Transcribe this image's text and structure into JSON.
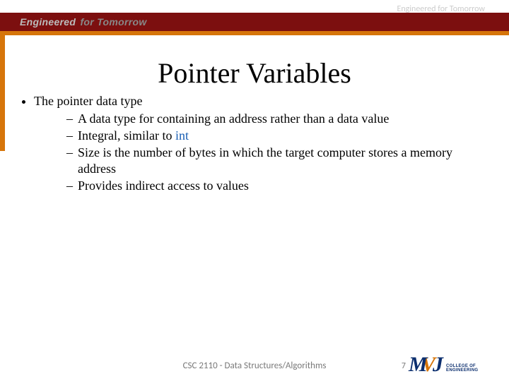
{
  "header": {
    "tagline_overlay": "Engineered for Tomorrow",
    "band_text_1": "Engineered",
    "band_text_2": "for Tomorrow"
  },
  "title": "Pointer Variables",
  "bullets": {
    "l1": "The pointer data type",
    "l2_1": "A data type for containing an address rather than a data value",
    "l2_2_pre": "Integral, similar to ",
    "l2_2_kw": "int",
    "l2_3": "Size is the number of bytes in which the target computer stores a memory address",
    "l2_4": "Provides indirect access to values"
  },
  "footer": {
    "course": "CSC 2110 - Data Structures/Algorithms",
    "page": "7"
  },
  "logo": {
    "m": "M",
    "v": "V",
    "j": "J",
    "line1": "COLLEGE OF",
    "line2": "ENGINEERING"
  }
}
